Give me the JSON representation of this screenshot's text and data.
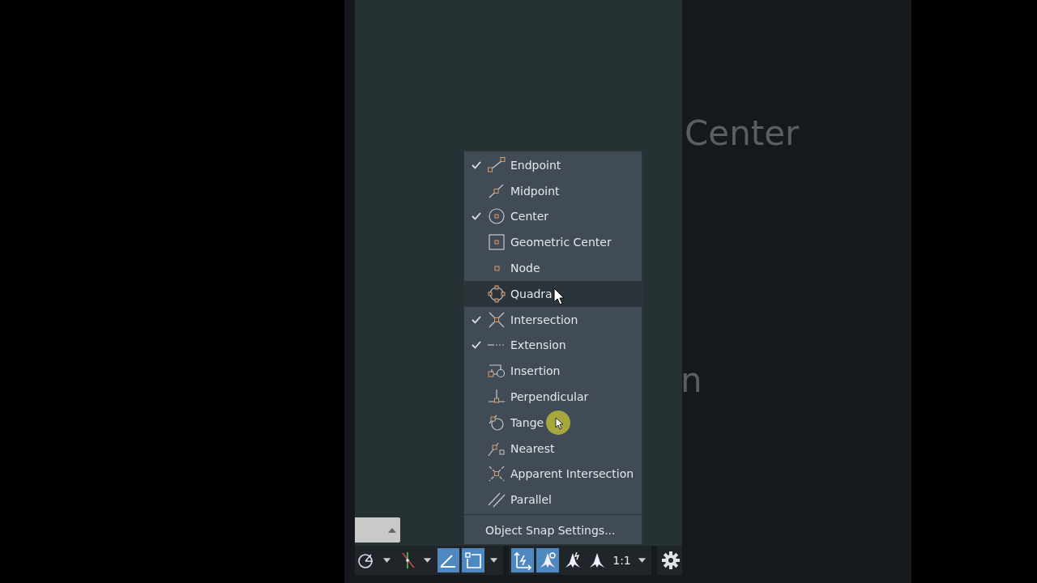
{
  "background_text": [
    "Center",
    "n"
  ],
  "menu": {
    "items": [
      {
        "kind": "endpoint",
        "label": "Endpoint",
        "checked": true,
        "selected": false
      },
      {
        "kind": "midpoint",
        "label": "Midpoint",
        "checked": false,
        "selected": false
      },
      {
        "kind": "center",
        "label": "Center",
        "checked": true,
        "selected": false
      },
      {
        "kind": "geocenter",
        "label": "Geometric Center",
        "checked": false,
        "selected": false
      },
      {
        "kind": "node",
        "label": "Node",
        "checked": false,
        "selected": false
      },
      {
        "kind": "quadrant",
        "label": "Quadra",
        "checked": false,
        "selected": true
      },
      {
        "kind": "intersection",
        "label": "Intersection",
        "checked": true,
        "selected": false
      },
      {
        "kind": "extension",
        "label": "Extension",
        "checked": true,
        "selected": false
      },
      {
        "kind": "insertion",
        "label": "Insertion",
        "checked": false,
        "selected": false
      },
      {
        "kind": "perpendicular",
        "label": "Perpendicular",
        "checked": false,
        "selected": false
      },
      {
        "kind": "tangent",
        "label": "Tange",
        "checked": false,
        "selected": false
      },
      {
        "kind": "nearest",
        "label": "Nearest",
        "checked": false,
        "selected": false
      },
      {
        "kind": "apparent",
        "label": "Apparent Intersection",
        "checked": false,
        "selected": false
      },
      {
        "kind": "parallel",
        "label": "Parallel",
        "checked": false,
        "selected": false
      }
    ],
    "settings": "Object Snap Settings..."
  },
  "status_bar": {
    "tools": [
      {
        "kind": "polar",
        "on": false
      },
      {
        "kind": "caret"
      },
      {
        "kind": "isodraft",
        "on": false
      },
      {
        "kind": "caret"
      },
      {
        "kind": "angle",
        "on": true
      },
      {
        "kind": "osnap",
        "on": true
      },
      {
        "kind": "caret"
      },
      {
        "kind": "gap"
      },
      {
        "kind": "ucs",
        "on": true
      },
      {
        "kind": "annovis",
        "on": true
      },
      {
        "kind": "autoscale",
        "on": false
      },
      {
        "kind": "annoscale",
        "on": false
      },
      {
        "kind": "scale",
        "label": "1:1"
      },
      {
        "kind": "caret"
      },
      {
        "kind": "gap"
      },
      {
        "kind": "gear"
      }
    ]
  }
}
